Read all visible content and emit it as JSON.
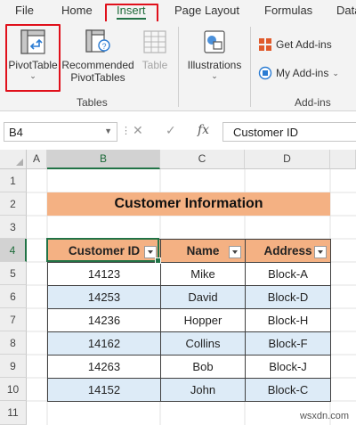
{
  "ribbon_tabs": [
    "File",
    "Home",
    "Insert",
    "Page Layout",
    "Formulas",
    "Data"
  ],
  "active_tab": "Insert",
  "ribbon": {
    "pivottable_label": "PivotTable",
    "recommended_label_1": "Recommended",
    "recommended_label_2": "PivotTables",
    "table_label": "Table",
    "tables_group_label": "Tables",
    "illustrations_label": "Illustrations",
    "get_addins_label": "Get Add-ins",
    "my_addins_label": "My Add-ins",
    "addins_group_label": "Add-ins",
    "caret": "⌄"
  },
  "formula_bar": {
    "name_box": "B4",
    "cancel_icon": "✕",
    "enter_icon": "✓",
    "fx_icon": "fx",
    "formula_value": "Customer ID"
  },
  "columns": [
    "A",
    "B",
    "C",
    "D"
  ],
  "selected_column": "B",
  "rows": [
    "1",
    "2",
    "3",
    "4",
    "5",
    "6",
    "7",
    "8",
    "9",
    "10",
    "11"
  ],
  "selected_row": "4",
  "sheet_title": "Customer Information",
  "table": {
    "headers": [
      "Customer ID",
      "Name",
      "Address"
    ],
    "rows": [
      [
        "14123",
        "Mike",
        "Block-A"
      ],
      [
        "14253",
        "David",
        "Block-D"
      ],
      [
        "14236",
        "Hopper",
        "Block-H"
      ],
      [
        "14162",
        "Collins",
        "Block-F"
      ],
      [
        "14263",
        "Bob",
        "Block-J"
      ],
      [
        "14152",
        "John",
        "Block-C"
      ]
    ]
  },
  "colors": {
    "header_fill": "#f4b183",
    "band_fill": "#ddebf7",
    "excel_green": "#217346",
    "highlight_red": "#e0101b"
  },
  "watermark": "wsxdn.com"
}
